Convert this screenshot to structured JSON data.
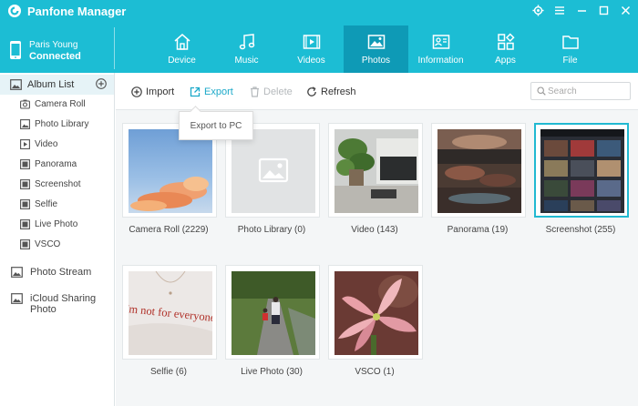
{
  "app": {
    "title": "Panfone Manager"
  },
  "device": {
    "name": "Paris Young",
    "status": "Connected"
  },
  "nav": [
    {
      "label": "Device",
      "icon": "home-icon"
    },
    {
      "label": "Music",
      "icon": "music-icon"
    },
    {
      "label": "Videos",
      "icon": "video-icon"
    },
    {
      "label": "Photos",
      "icon": "photo-icon",
      "active": true
    },
    {
      "label": "Information",
      "icon": "contact-card-icon"
    },
    {
      "label": "Apps",
      "icon": "apps-icon"
    },
    {
      "label": "File",
      "icon": "folder-icon"
    }
  ],
  "sidebar": {
    "album_list": "Album List",
    "albums": [
      {
        "label": "Camera Roll",
        "icon": "camera-icon"
      },
      {
        "label": "Photo Library",
        "icon": "photo-library-icon"
      },
      {
        "label": "Video",
        "icon": "video-play-icon"
      },
      {
        "label": "Panorama",
        "icon": "panorama-icon"
      },
      {
        "label": "Screenshot",
        "icon": "screenshot-icon"
      },
      {
        "label": "Selfie",
        "icon": "selfie-icon"
      },
      {
        "label": "Live Photo",
        "icon": "live-photo-icon"
      },
      {
        "label": "VSCO",
        "icon": "vsco-icon"
      }
    ],
    "photo_stream": "Photo Stream",
    "icloud": "iCloud Sharing Photo"
  },
  "toolbar": {
    "import": "Import",
    "export": "Export",
    "delete": "Delete",
    "refresh": "Refresh",
    "search_placeholder": "Search"
  },
  "tooltip": {
    "export_to_pc": "Export to PC"
  },
  "albums_grid": [
    {
      "caption": "Camera Roll (2229)"
    },
    {
      "caption": "Photo Library (0)"
    },
    {
      "caption": "Video (143)"
    },
    {
      "caption": "Panorama (19)"
    },
    {
      "caption": "Screenshot (255)",
      "selected": true
    },
    {
      "caption": "Selfie (6)",
      "thumb_text": "'m not for everyone."
    },
    {
      "caption": "Live Photo (30)"
    },
    {
      "caption": "VSCO (1)"
    }
  ],
  "colors": {
    "accent": "#1cbdd4",
    "active_tab": "#0e9ab6",
    "selection": "#21b9d1"
  }
}
